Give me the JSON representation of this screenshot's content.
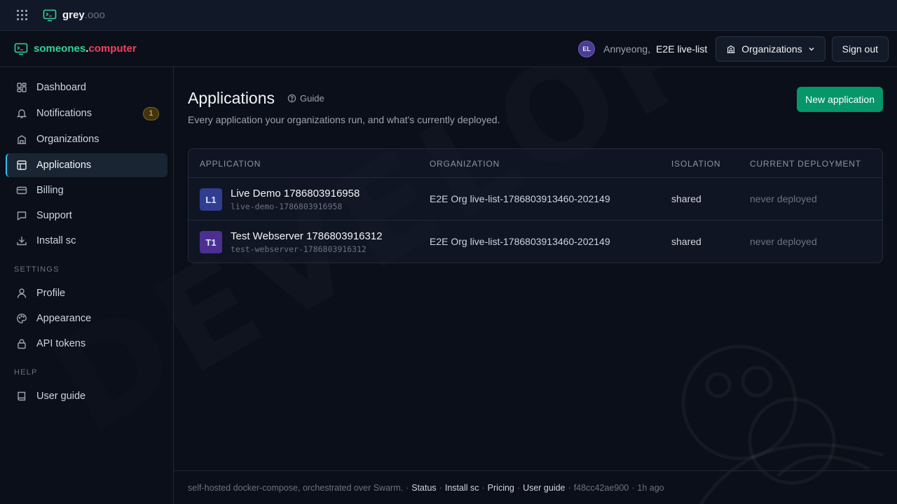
{
  "topbar": {
    "brand_name": "grey",
    "brand_domain": ".ooo"
  },
  "header": {
    "brand": {
      "part1": "someones",
      "part2": ".",
      "part3": "computer"
    },
    "user": {
      "initials": "EL",
      "greeting": "Annyeong,",
      "name": "E2E live-list"
    },
    "org_button": "Organizations",
    "signout_button": "Sign out"
  },
  "sidebar": {
    "items": [
      {
        "label": "Dashboard",
        "icon": "dashboard-icon"
      },
      {
        "label": "Notifications",
        "icon": "bell-icon",
        "badge": "1"
      },
      {
        "label": "Organizations",
        "icon": "building-icon"
      },
      {
        "label": "Applications",
        "icon": "application-icon",
        "active": true
      },
      {
        "label": "Billing",
        "icon": "credit-card-icon"
      },
      {
        "label": "Support",
        "icon": "chat-icon"
      },
      {
        "label": "Install sc",
        "icon": "download-icon"
      }
    ],
    "settings_label": "SETTINGS",
    "settings_items": [
      {
        "label": "Profile",
        "icon": "user-icon"
      },
      {
        "label": "Appearance",
        "icon": "palette-icon"
      },
      {
        "label": "API tokens",
        "icon": "lock-icon"
      }
    ],
    "help_label": "HELP",
    "help_items": [
      {
        "label": "User guide",
        "icon": "book-icon"
      }
    ]
  },
  "main": {
    "title": "Applications",
    "guide_label": "Guide",
    "subtitle": "Every application your organizations run, and what's currently deployed.",
    "new_button": "New application",
    "table": {
      "headers": [
        "APPLICATION",
        "ORGANIZATION",
        "ISOLATION",
        "CURRENT DEPLOYMENT"
      ],
      "rows": [
        {
          "badge": "L1",
          "name": "Live Demo 1786803916958",
          "slug": "live-demo-1786803916958",
          "organization": "E2E Org live-list-1786803913460-202149",
          "isolation": "shared",
          "deployment": "never deployed"
        },
        {
          "badge": "T1",
          "name": "Test Webserver 1786803916312",
          "slug": "test-webserver-1786803916312",
          "organization": "E2E Org live-list-1786803913460-202149",
          "isolation": "shared",
          "deployment": "never deployed"
        }
      ]
    }
  },
  "footer": {
    "text": "self-hosted docker-compose, orchestrated over Swarm.",
    "links": [
      "Status",
      "Install sc",
      "Pricing",
      "User guide"
    ],
    "commit": "f48cc42ae900",
    "age": "1h ago"
  },
  "watermark": {
    "text": "DEVELOPER"
  },
  "colors": {
    "accent_green": "#059669",
    "brand_green": "#34d399",
    "brand_red": "#f43f5e",
    "active_indicator": "#38bdf8",
    "badge_amber": "#fbbf24"
  }
}
